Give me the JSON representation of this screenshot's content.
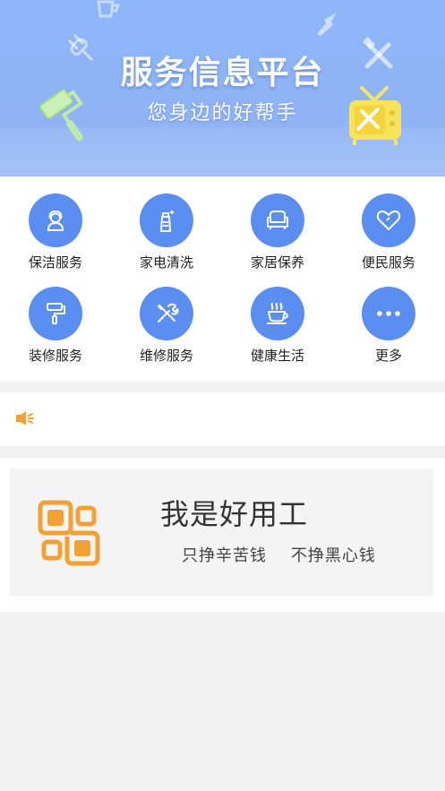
{
  "banner": {
    "title": "服务信息平台",
    "subtitle": "您身边的好帮手"
  },
  "categories": [
    {
      "label": "保洁服务",
      "icon": "cleaner-person-icon"
    },
    {
      "label": "家电清洗",
      "icon": "spray-bottle-icon"
    },
    {
      "label": "家居保养",
      "icon": "sofa-icon"
    },
    {
      "label": "便民服务",
      "icon": "heart-icon"
    },
    {
      "label": "装修服务",
      "icon": "paint-roller-icon"
    },
    {
      "label": "维修服务",
      "icon": "tools-icon"
    },
    {
      "label": "健康生活",
      "icon": "coffee-cup-icon"
    },
    {
      "label": "更多",
      "icon": "more-dots-icon"
    }
  ],
  "notice": {
    "icon": "speaker-icon",
    "text": ""
  },
  "promo": {
    "title": "我是好用工",
    "slogan": "只挣辛苦钱    不挣黑心钱"
  },
  "colors": {
    "primary": "#5a8ef1",
    "banner": "#8db6f8",
    "accent_orange": "#f5a033",
    "background": "#f2f2f2"
  }
}
